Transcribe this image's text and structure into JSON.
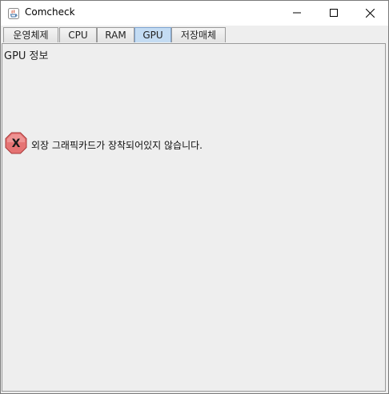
{
  "window": {
    "title": "Comcheck",
    "icon": "java-app-icon",
    "controls": {
      "minimize_icon": "minimize-icon",
      "maximize_icon": "maximize-icon",
      "close_icon": "close-icon"
    }
  },
  "tabs": [
    {
      "label": "운영체제",
      "selected": false
    },
    {
      "label": "CPU",
      "selected": false
    },
    {
      "label": "RAM",
      "selected": false
    },
    {
      "label": "GPU",
      "selected": true
    },
    {
      "label": "저장매체",
      "selected": false
    }
  ],
  "panel": {
    "title": "GPU 정보",
    "error": {
      "icon": "error-icon",
      "icon_letter": "X",
      "icon_color": "#e57373",
      "message": "외장 그래픽카드가 장착되어있지 않습니다."
    }
  },
  "colors": {
    "selected_tab": "#c4dcf3",
    "background": "#eeeeee"
  }
}
